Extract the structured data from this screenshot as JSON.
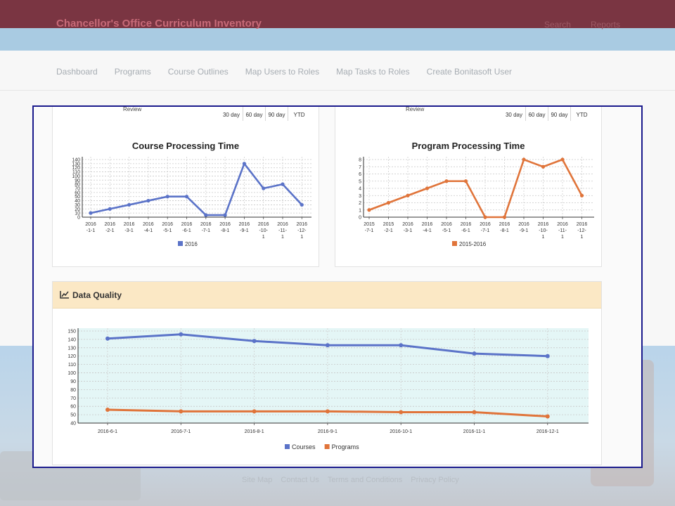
{
  "app": {
    "title": "Chancellor's Office Curriculum Inventory",
    "top_links": [
      "Search",
      "Reports"
    ]
  },
  "nav": {
    "items": [
      "Dashboard",
      "Programs",
      "Course Outlines",
      "Map Users to Roles",
      "Map Tasks to Roles",
      "Create Bonitasoft User"
    ]
  },
  "panels": {
    "left": {
      "review_label": "Review",
      "ranges": [
        "30 day",
        "60 day",
        "90 day",
        "YTD"
      ]
    },
    "right": {
      "review_label": "Review",
      "ranges": [
        "30 day",
        "60 day",
        "90 day",
        "YTD"
      ]
    }
  },
  "data_quality": {
    "title": "Data Quality",
    "icon": "line-chart-icon"
  },
  "footer": {
    "links": [
      "Site Map",
      "Contact Us",
      "Terms and Conditions",
      "Privacy Policy"
    ]
  },
  "colors": {
    "course_series": "#5b73c8",
    "program_series": "#e0743a",
    "header_bar": "#7a3542",
    "data_quality_header": "#fbe8c5",
    "frame_border": "#1a1a8c"
  },
  "chart_data": [
    {
      "type": "line",
      "title": "Course Processing Time",
      "x": [
        "2016-1-1",
        "2016-2-1",
        "2016-3-1",
        "2016-4-1",
        "2016-5-1",
        "2016-6-1",
        "2016-7-1",
        "2016-8-1",
        "2016-9-1",
        "2016-10-1",
        "2016-11-1",
        "2016-12-1"
      ],
      "y_ticks": [
        0,
        10,
        20,
        30,
        40,
        50,
        60,
        70,
        80,
        90,
        100,
        110,
        120,
        130,
        140
      ],
      "ylim": [
        0,
        140
      ],
      "grid": true,
      "legend": "bottom",
      "series": [
        {
          "name": "2016",
          "values": [
            10,
            20,
            30,
            40,
            50,
            50,
            5,
            5,
            130,
            70,
            80,
            30
          ]
        }
      ]
    },
    {
      "type": "line",
      "title": "Program Processing Time",
      "x": [
        "2015-7-1",
        "2015-2-1",
        "2016-3-1",
        "2016-4-1",
        "2016-5-1",
        "2016-6-1",
        "2016-7-1",
        "2016-8-1",
        "2016-9-1",
        "2016-10-1",
        "2016-11-1",
        "2016-12-1"
      ],
      "y_ticks": [
        0,
        1,
        2,
        3,
        4,
        5,
        6,
        7,
        8
      ],
      "ylim": [
        0,
        8
      ],
      "grid": true,
      "legend": "bottom",
      "series": [
        {
          "name": "2015-2016",
          "values": [
            1,
            2,
            3,
            4,
            5,
            5,
            0,
            0,
            8,
            7,
            8,
            3
          ]
        }
      ]
    },
    {
      "type": "line",
      "title": "",
      "x": [
        "2016-6-1",
        "2016-7-1",
        "2016-8-1",
        "2016-9-1",
        "2016-10-1",
        "2016-11-1",
        "2016-12-1"
      ],
      "y_ticks": [
        40,
        50,
        60,
        70,
        80,
        90,
        100,
        110,
        120,
        130,
        140,
        150
      ],
      "ylim": [
        40,
        150
      ],
      "grid": true,
      "legend": "bottom",
      "series": [
        {
          "name": "Courses",
          "values": [
            141,
            146,
            138,
            133,
            133,
            123,
            120
          ]
        },
        {
          "name": "Programs",
          "values": [
            56,
            54,
            54,
            54,
            53,
            53,
            48
          ]
        }
      ]
    }
  ]
}
